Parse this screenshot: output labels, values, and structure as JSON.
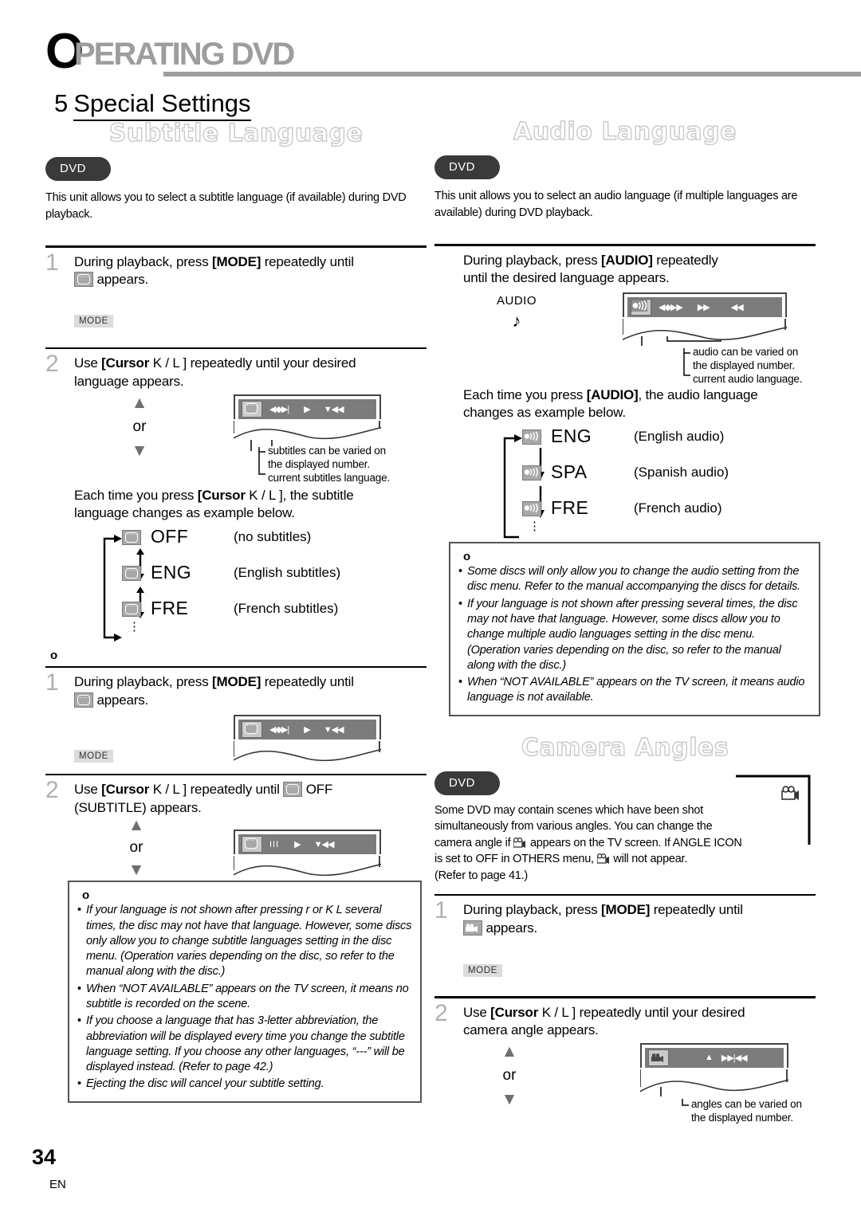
{
  "header": {
    "first_letter": "O",
    "rest": "PERATING DVD"
  },
  "chapter": {
    "number": "5",
    "title": "Special Settings"
  },
  "page_footer": {
    "number": "34",
    "lang": "EN"
  },
  "subtitle_section": {
    "title": "Subtitle Language",
    "badge": "DVD",
    "intro": "This unit allows you to select a subtitle language (if available) during DVD playback.",
    "step1": {
      "num": "1",
      "text_before": "During playback, press ",
      "key": "[MODE]",
      "text_after": " repeatedly until",
      "line2_after": " appears.",
      "button_badge": "MODE"
    },
    "step2": {
      "num": "2",
      "text_before": "Use ",
      "key": "[Cursor",
      "key_rest": "K / L ]",
      "text_after": " repeatedly until your desired",
      "line2": "language appears.",
      "or_label": "or",
      "callout1": "subtitles can be varied on",
      "callout1b": "the displayed number.",
      "callout2": "current subtitles language."
    },
    "cycle_intro_a": "Each time you press ",
    "cycle_intro_key": "[Cursor",
    "cycle_intro_key_rest": "K / L ]",
    "cycle_intro_b": ", the subtitle",
    "cycle_intro_line2": "language changes as example below.",
    "cycle": [
      {
        "icon": "subtitle-icon",
        "code": "OFF",
        "desc": "(no subtitles)"
      },
      {
        "icon": "subtitle-icon",
        "code": "ENG",
        "desc": "(English subtitles)"
      },
      {
        "icon": "subtitle-icon",
        "code": "FRE",
        "desc": "(French subtitles)"
      }
    ],
    "cancel_heading": "o",
    "cancel_step1": {
      "num": "1",
      "text_before": "During playback, press ",
      "key": "[MODE]",
      "text_after": " repeatedly until",
      "line2_after": " appears.",
      "button_badge": "MODE"
    },
    "cancel_step2": {
      "num": "2",
      "text_before": "Use ",
      "key": "[Cursor",
      "key_rest": "K / L ]",
      "text_mid": " repeatedly until ",
      "text_off": " OFF",
      "line2": "(SUBTITLE)  appears.",
      "or_label": "or"
    },
    "note": {
      "heading": "o",
      "items": [
        "If your language is not shown after pressing        r  or K   L  several times, the disc may not have that language. However, some discs only allow you to change subtitle languages setting in the disc menu. (Operation varies depending on the disc, so refer to the manual along with the disc.)",
        "When “NOT AVAILABLE” appears on the TV screen, it means no subtitle is recorded on the scene.",
        "If you choose a language that has 3-letter abbreviation, the abbreviation will be displayed every time you change the subtitle language setting. If you choose any other languages, “---” will be displayed instead. (Refer to page 42.)",
        "Ejecting the disc will cancel your subtitle setting."
      ]
    }
  },
  "audio_section": {
    "title": "Audio Language",
    "badge": "DVD",
    "intro": "This unit allows you to select an audio language (if multiple languages are available) during DVD playback.",
    "step": {
      "text_before": "During playback, press ",
      "key": "[AUDIO]",
      "text_after": " repeatedly",
      "line2": "until the desired language appears.",
      "button_label": "AUDIO",
      "button_glyph": "♪",
      "callout1": "audio can be varied on",
      "callout1b": "the displayed number.",
      "callout2": "current audio language."
    },
    "cycle_intro_a": "Each time you press ",
    "cycle_intro_key": "[AUDIO]",
    "cycle_intro_b": ", the audio language",
    "cycle_intro_line2": "changes as example below.",
    "cycle": [
      {
        "icon": "audio-icon",
        "code": "ENG",
        "desc": "(English audio)"
      },
      {
        "icon": "audio-icon",
        "code": "SPA",
        "desc": "(Spanish audio)"
      },
      {
        "icon": "audio-icon",
        "code": "FRE",
        "desc": "(French audio)"
      }
    ],
    "note": {
      "heading": "o",
      "items": [
        "Some discs will only allow you to change the audio setting from the disc menu. Refer to the manual accompanying the discs for details.",
        "If your language is not shown after pressing                      several times, the disc may not have that language. However, some discs allow you to change multiple audio languages setting in the disc menu. (Operation varies depending on the disc, so refer to the manual along with the disc.)",
        "When “NOT AVAILABLE” appears on the TV screen, it means audio language is not available."
      ]
    }
  },
  "camera_section": {
    "title": "Camera Angles",
    "badge": "DVD",
    "intro_l1": "Some DVD may contain scenes which have been shot",
    "intro_l2": "simultaneously from various angles. You can change the",
    "intro_l3a": "camera angle if ",
    "intro_l3b": " appears on the TV screen. If  ANGLE ICON",
    "intro_l4a": "is set to  OFF  in  OTHERS  menu, ",
    "intro_l4b": " will not appear.",
    "intro_l5": "(Refer to page 41.)",
    "step1": {
      "num": "1",
      "text_before": "During playback, press ",
      "key": "[MODE]",
      "text_after": " repeatedly until",
      "line2_after": " appears.",
      "button_badge": "MODE"
    },
    "step2": {
      "num": "2",
      "text_before": "Use ",
      "key": "[Cursor",
      "key_rest": "K / L ]",
      "text_after": " repeatedly until your desired",
      "line2": "camera angle appears.",
      "or_label": "or",
      "callout1": "angles can be varied on",
      "callout1b": "the displayed number."
    }
  },
  "icons": {
    "subtitle": "subtitle-icon",
    "audio": "audio-icon",
    "camera": "camera-icon",
    "play": "▶",
    "prev": "▼◀◀",
    "pause": "III",
    "eject": "▲"
  },
  "colors": {
    "badge_bg": "#3a3a3a",
    "osd_bar": "#7c7c7c",
    "title_outline": "#c9c9c9",
    "step_num": "#b0b0b0"
  }
}
